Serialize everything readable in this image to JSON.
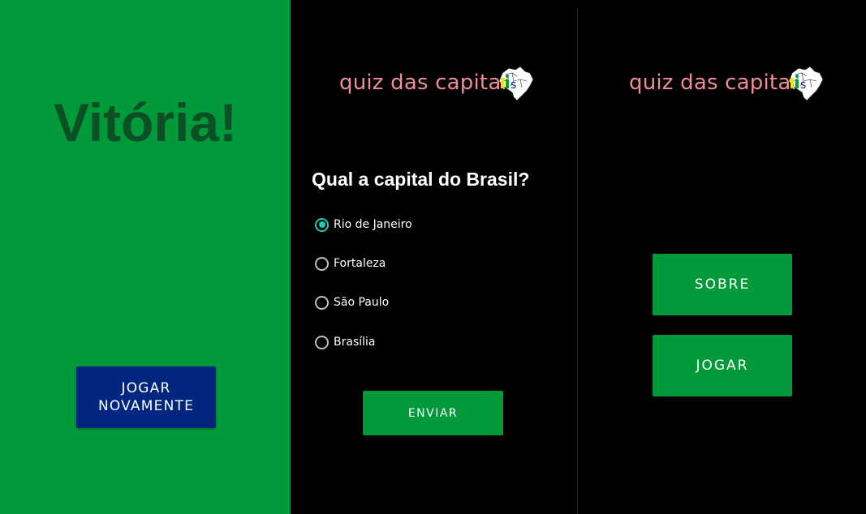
{
  "victory_screen": {
    "title": "Vitória!",
    "play_again_line1": "JOGAR",
    "play_again_line2": "NOVAMENTE",
    "background_color": "#009a3b",
    "title_color": "#0b4f24",
    "button_color": "#00267f"
  },
  "quiz_screen": {
    "logo_text": "quiz das capitais",
    "logo_icon": "brazil-map-icon",
    "question": "Qual a capital do Brasil?",
    "options": [
      {
        "label": "Rio de Janeiro",
        "selected": true
      },
      {
        "label": "Fortaleza",
        "selected": false
      },
      {
        "label": "São Paulo",
        "selected": false
      },
      {
        "label": "Brasília",
        "selected": false
      }
    ],
    "submit_label": "ENVIAR",
    "accent_color": "#1fc8b0",
    "button_color": "#009a3b"
  },
  "home_screen": {
    "logo_text": "quiz das capitais",
    "logo_icon": "brazil-map-icon",
    "about_label": "SOBRE",
    "play_label": "JOGAR",
    "button_color": "#009a3b"
  },
  "colors": {
    "logo_text": "#f08c98",
    "flag_yellow": "#ffdf00",
    "flag_blue": "#002776",
    "flag_green": "#009c3b"
  }
}
